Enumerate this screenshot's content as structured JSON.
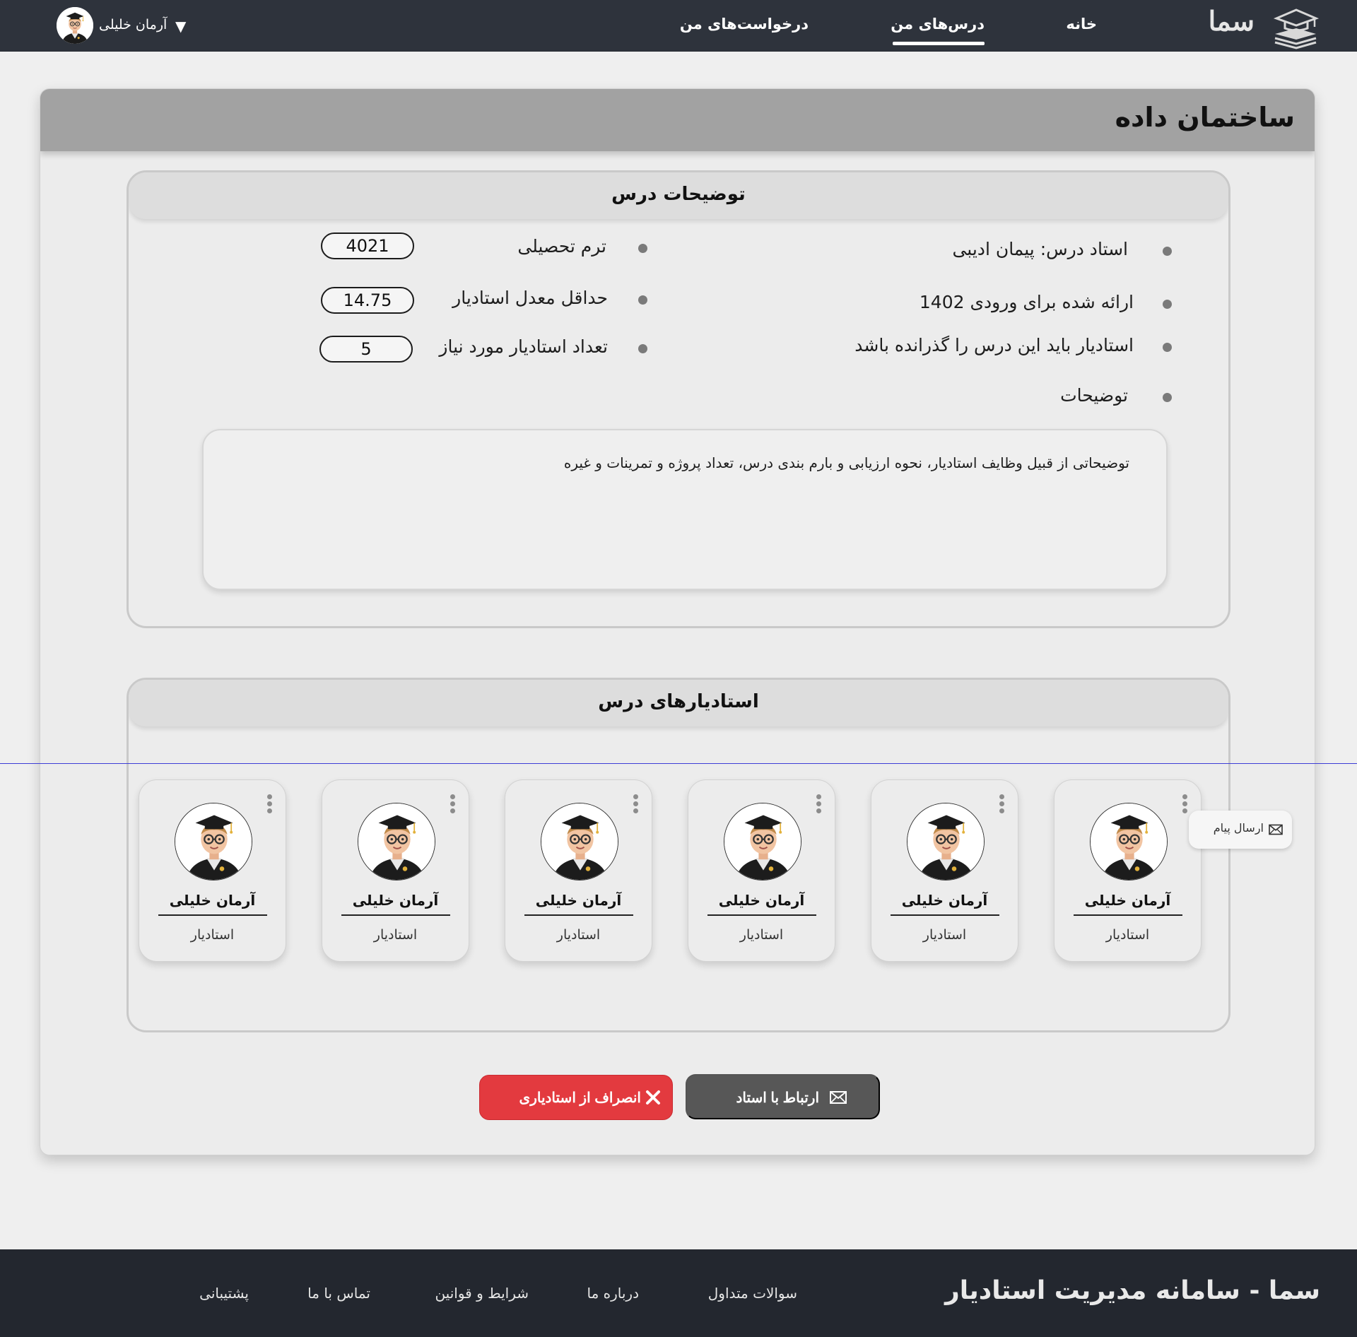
{
  "nav": {
    "brand": "سما",
    "links": [
      {
        "label": "خانه"
      },
      {
        "label": "درس‌های من",
        "active": true
      },
      {
        "label": "درخواست‌های من"
      }
    ],
    "user": {
      "name": "آرمان خلیلی",
      "caret": "▼"
    }
  },
  "page": {
    "title": "ساختمان داده"
  },
  "course_details": {
    "title": "توضیحات درس",
    "instructor": "استاد درس: پیمان ادیبی",
    "offered_for": "ارائه شده برای  ورودی  1402",
    "prerequisite": "استادیار باید این درس را گذرانده باشد",
    "description_label": "توضیحات",
    "term_label": "ترم تحصیلی",
    "term_value": "4021",
    "min_gpa_label": "حداقل معدل استادیار",
    "min_gpa_value": "14.75",
    "ta_count_label": "تعداد استادیار مورد نیاز",
    "ta_count_value": "5",
    "description_text": "توضیحاتی از قبیل وظایف استادیار، نحوه ارزیابی و بارم بندی درس، تعداد پروژه و تمرینات و غیره"
  },
  "tas": {
    "title": "استادیارهای درس",
    "items": [
      {
        "name": "آرمان خلیلی",
        "role": "استادیار"
      },
      {
        "name": "آرمان خلیلی",
        "role": "استادیار"
      },
      {
        "name": "آرمان خلیلی",
        "role": "استادیار"
      },
      {
        "name": "آرمان خلیلی",
        "role": "استادیار"
      },
      {
        "name": "آرمان خلیلی",
        "role": "استادیار"
      },
      {
        "name": "آرمان خلیلی",
        "role": "استادیار"
      }
    ],
    "popup_label": "ارسال پیام"
  },
  "actions": {
    "contact_label": "ارتباط با استاد",
    "withdraw_label": "انصراف از استادیاری"
  },
  "footer": {
    "title": "سما - سامانه مدیریت استادیار",
    "links": [
      {
        "label": "سوالات متداول"
      },
      {
        "label": "درباره ما"
      },
      {
        "label": "شرایط و قوانین"
      },
      {
        "label": "تماس با ما"
      },
      {
        "label": "پشتیبانی"
      }
    ]
  },
  "colors": {
    "navbar": "#2e333c",
    "footer": "#23272f",
    "danger": "#e33a3f",
    "dark_button": "#575757"
  }
}
